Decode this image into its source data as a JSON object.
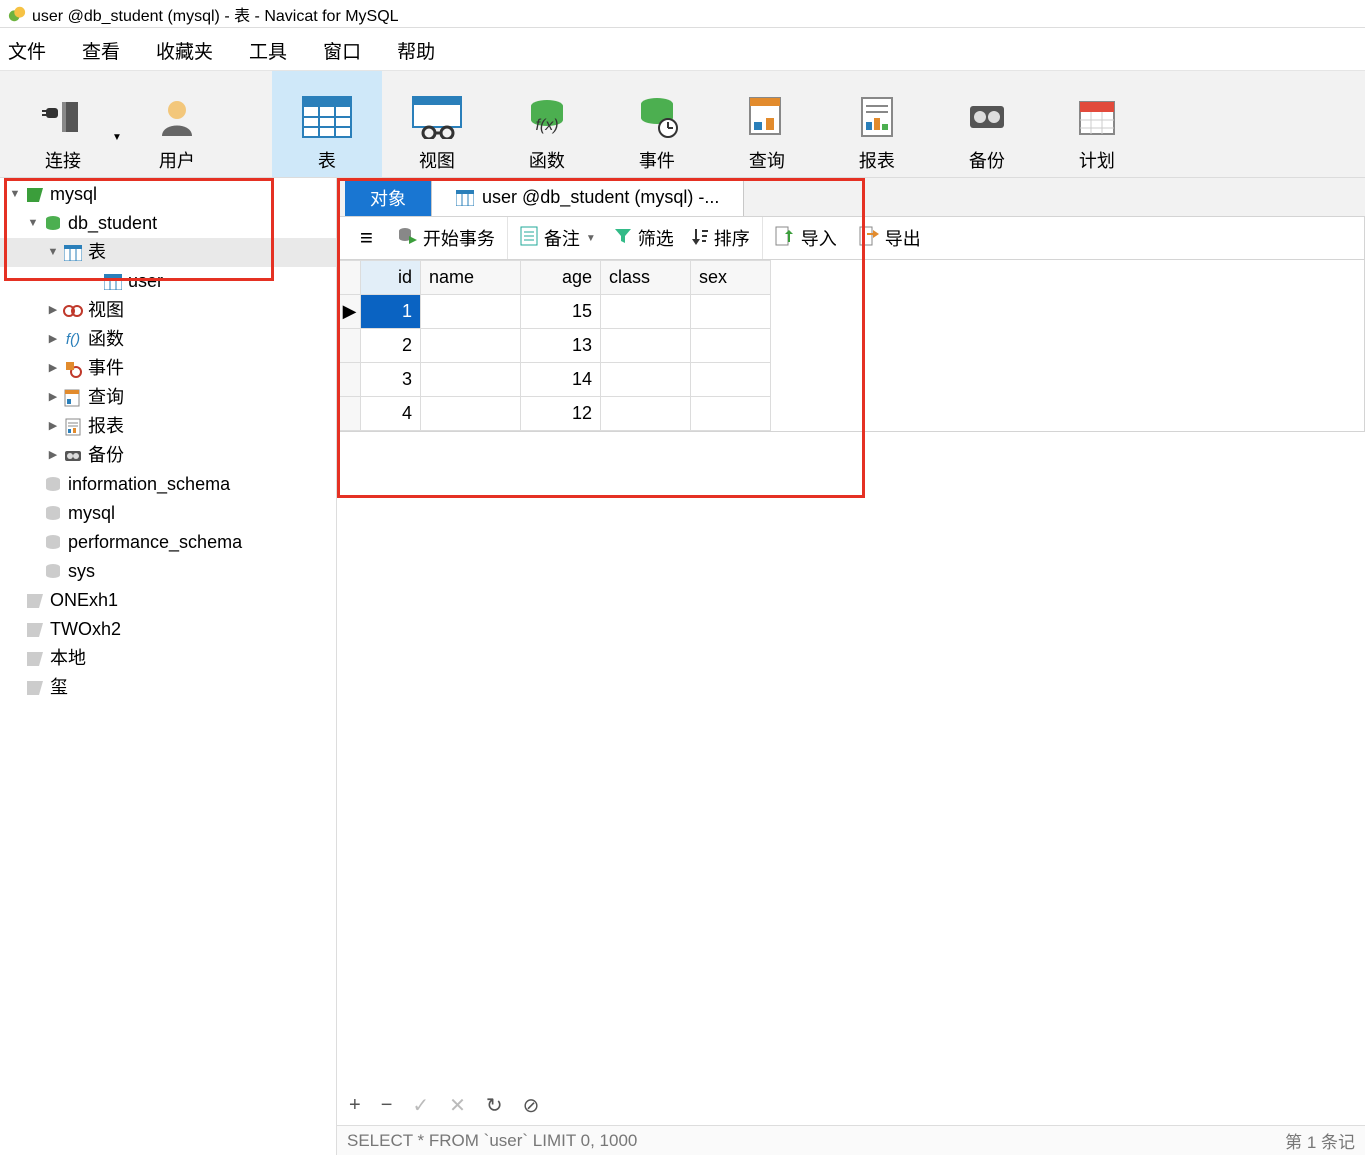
{
  "title": "user @db_student (mysql) - 表 - Navicat for MySQL",
  "menu": {
    "items": [
      "文件",
      "查看",
      "收藏夹",
      "工具",
      "窗口",
      "帮助"
    ]
  },
  "toolbar": {
    "items": [
      {
        "label": "连接"
      },
      {
        "label": "用户"
      },
      {
        "label": "表",
        "active": true
      },
      {
        "label": "视图"
      },
      {
        "label": "函数"
      },
      {
        "label": "事件"
      },
      {
        "label": "查询"
      },
      {
        "label": "报表"
      },
      {
        "label": "备份"
      },
      {
        "label": "计划"
      }
    ]
  },
  "tree": {
    "rows": [
      {
        "indent": 0,
        "tw": "v",
        "icon": "conn-green",
        "label": "mysql"
      },
      {
        "indent": 1,
        "tw": "v",
        "icon": "db-green",
        "label": "db_student"
      },
      {
        "indent": 2,
        "tw": "v",
        "icon": "table",
        "label": "表",
        "sel": true
      },
      {
        "indent": 3,
        "tw": "",
        "icon": "table",
        "label": "user"
      },
      {
        "indent": 2,
        "tw": ">",
        "icon": "view",
        "label": "视图"
      },
      {
        "indent": 2,
        "tw": ">",
        "icon": "func",
        "label": "函数"
      },
      {
        "indent": 2,
        "tw": ">",
        "icon": "event",
        "label": "事件"
      },
      {
        "indent": 2,
        "tw": ">",
        "icon": "query",
        "label": "查询"
      },
      {
        "indent": 2,
        "tw": ">",
        "icon": "report",
        "label": "报表"
      },
      {
        "indent": 2,
        "tw": ">",
        "icon": "backup",
        "label": "备份"
      },
      {
        "indent": 1,
        "tw": "",
        "icon": "db-grey",
        "label": "information_schema"
      },
      {
        "indent": 1,
        "tw": "",
        "icon": "db-grey",
        "label": "mysql"
      },
      {
        "indent": 1,
        "tw": "",
        "icon": "db-grey",
        "label": "performance_schema"
      },
      {
        "indent": 1,
        "tw": "",
        "icon": "db-grey",
        "label": "sys"
      },
      {
        "indent": 0,
        "tw": "",
        "icon": "conn-grey",
        "label": "ONExh1"
      },
      {
        "indent": 0,
        "tw": "",
        "icon": "conn-grey",
        "label": "TWOxh2"
      },
      {
        "indent": 0,
        "tw": "",
        "icon": "conn-grey",
        "label": "本地"
      },
      {
        "indent": 0,
        "tw": "",
        "icon": "conn-grey",
        "label": "玺"
      }
    ]
  },
  "tabs": {
    "items": [
      {
        "label": "对象",
        "active": true
      },
      {
        "label": "user @db_student (mysql) -...",
        "icon": "table"
      }
    ]
  },
  "actionbar": {
    "begin": "开始事务",
    "memo": "备注",
    "filter": "筛选",
    "sort": "排序",
    "import": "导入",
    "export": "导出"
  },
  "grid": {
    "columns": [
      "id",
      "name",
      "age",
      "class",
      "sex"
    ],
    "rows": [
      {
        "id": "1",
        "name": "",
        "age": "15",
        "class": "",
        "sex": "",
        "sel": true
      },
      {
        "id": "2",
        "name": "",
        "age": "13",
        "class": "",
        "sex": ""
      },
      {
        "id": "3",
        "name": "",
        "age": "14",
        "class": "",
        "sex": ""
      },
      {
        "id": "4",
        "name": "",
        "age": "12",
        "class": "",
        "sex": ""
      }
    ]
  },
  "status": {
    "sql": "SELECT * FROM `user` LIMIT 0, 1000",
    "pos": "第 1 条记"
  },
  "bottom": {
    "plus": "+",
    "minus": "−",
    "check": "✓",
    "x": "✕",
    "refresh": "↻",
    "stop": "⊘"
  }
}
